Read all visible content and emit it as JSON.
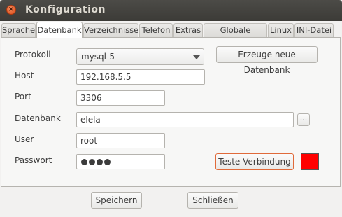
{
  "window": {
    "title": "Konfiguration"
  },
  "tabs": [
    {
      "label": "Sprache"
    },
    {
      "label": "Datenbank"
    },
    {
      "label": "Verzeichnisse"
    },
    {
      "label": "Telefon"
    },
    {
      "label": "Extras"
    },
    {
      "label": "Globale Params"
    },
    {
      "label": "Linux"
    },
    {
      "label": "INI-Datei"
    }
  ],
  "active_tab": "Datenbank",
  "form": {
    "protokoll": {
      "label": "Protokoll",
      "value": "mysql-5"
    },
    "host": {
      "label": "Host",
      "value": "192.168.5.5"
    },
    "port": {
      "label": "Port",
      "value": "3306"
    },
    "datenbank": {
      "label": "Datenbank",
      "value": "elela",
      "browse_label": "..."
    },
    "user": {
      "label": "User",
      "value": "root"
    },
    "passwort": {
      "label": "Passwort",
      "masked_length": 4
    }
  },
  "buttons": {
    "create_db": "Erzeuge neue Datenbank",
    "test_connection": "Teste Verbindung",
    "save": "Speichern",
    "close": "Schließen"
  },
  "status": {
    "connection_color": "#ff0000"
  },
  "icons": {
    "close": "close-icon",
    "dropdown": "chevron-down-icon"
  }
}
